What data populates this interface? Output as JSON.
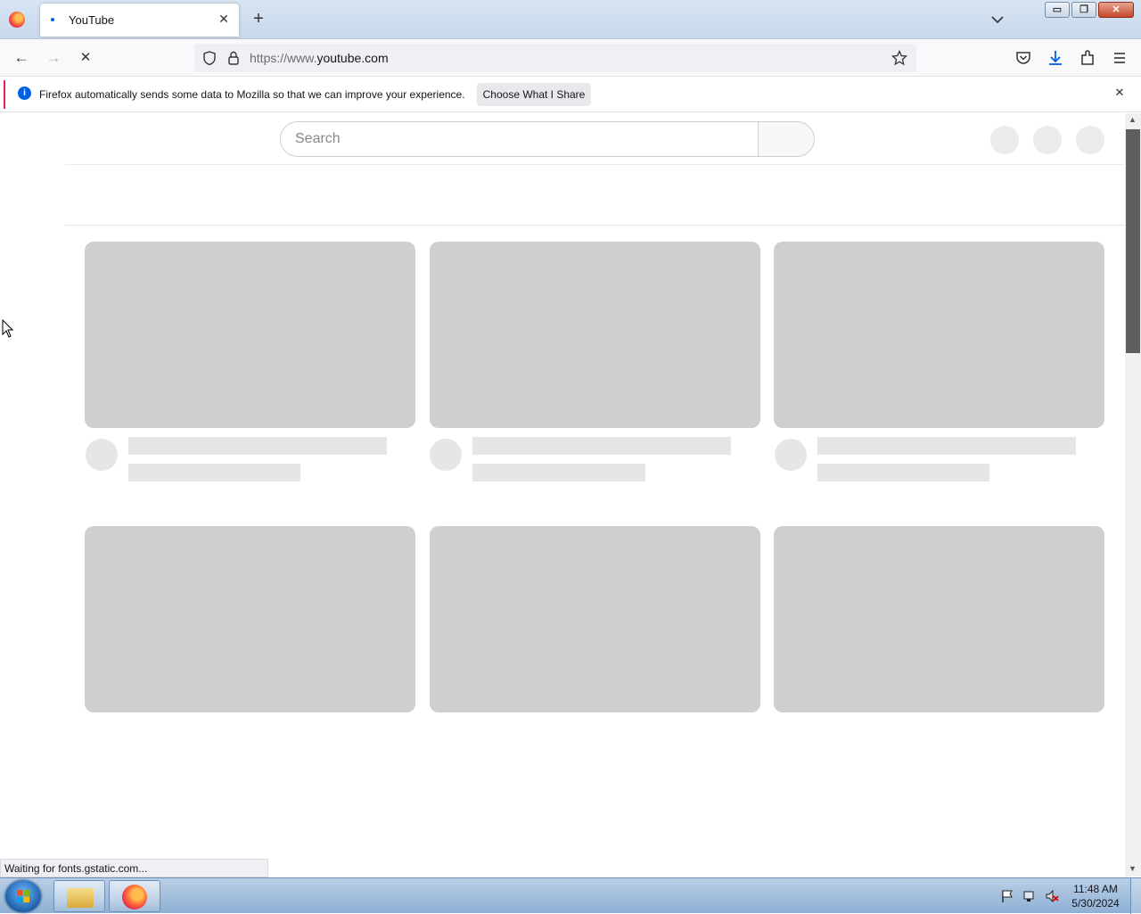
{
  "browser": {
    "tab": {
      "title": "YouTube",
      "close_glyph": "✕"
    },
    "new_tab_glyph": "+",
    "url": {
      "scheme_host_prefix": "https://www.",
      "host": "youtube.com"
    },
    "window_controls": {
      "minimize": "▭",
      "restore": "❐",
      "close": "✕"
    },
    "nav": {
      "back": "←",
      "forward": "→",
      "stop": "✕"
    }
  },
  "notification": {
    "text": "Firefox automatically sends some data to Mozilla so that we can improve your experience.",
    "button_label": "Choose What I Share",
    "close_glyph": "✕",
    "info_glyph": "i",
    "accent_color": "#e22850"
  },
  "youtube": {
    "search": {
      "placeholder": "Search"
    }
  },
  "status_bar": {
    "text": "Waiting for fonts.gstatic.com..."
  },
  "taskbar": {
    "clock": {
      "time": "11:48 AM",
      "date": "5/30/2024"
    }
  },
  "scrollbar": {
    "up": "▲",
    "down": "▼"
  }
}
